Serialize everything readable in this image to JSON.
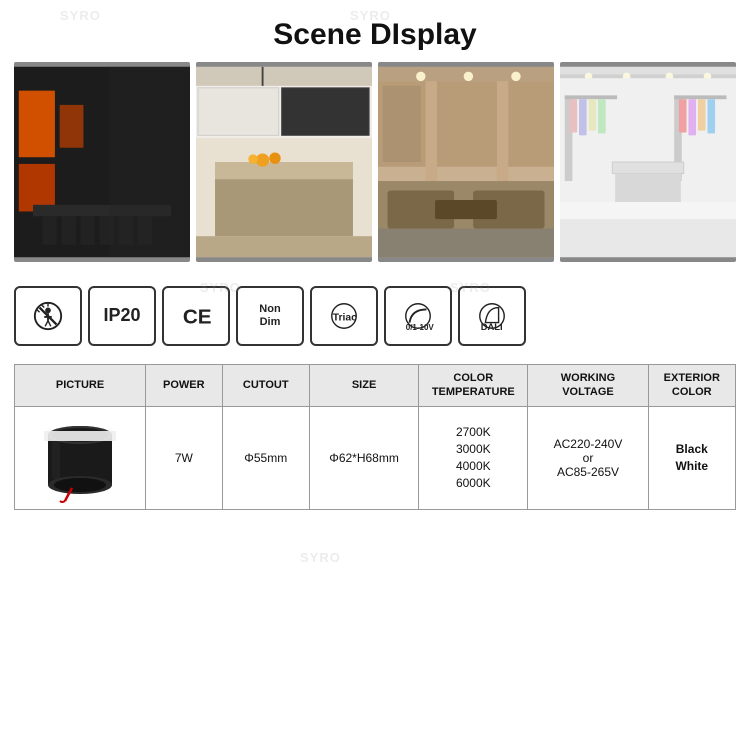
{
  "page": {
    "title": "Scene DIsplay",
    "watermarks": [
      "SYRO",
      "SYRO",
      "SYRO",
      "SYRO",
      "SYRO"
    ]
  },
  "scene_images": [
    {
      "id": 1,
      "alt": "Conference room with dark walls and orange lighting"
    },
    {
      "id": 2,
      "alt": "Modern kitchen with white and dark cabinets"
    },
    {
      "id": 3,
      "alt": "Restaurant or lobby with warm lighting"
    },
    {
      "id": 4,
      "alt": "Retail store with bright white lighting"
    }
  ],
  "icons": [
    {
      "id": "warning",
      "label": "Warning/Anti-glare",
      "symbol": "⚠"
    },
    {
      "id": "ip20",
      "label": "IP20",
      "text": "IP20"
    },
    {
      "id": "ce",
      "label": "CE",
      "text": "CE"
    },
    {
      "id": "non-dim",
      "label": "Non Dim",
      "text": "Non\nDim"
    },
    {
      "id": "triac",
      "label": "Triac",
      "text": "Triac"
    },
    {
      "id": "0-1-10v",
      "label": "0/1-10V",
      "text": "0/1-10V"
    },
    {
      "id": "dali",
      "label": "DALI",
      "text": "DALI"
    }
  ],
  "table": {
    "headers": [
      "PICTURE",
      "POWER",
      "CUTOUT",
      "SIZE",
      "COLOR\nTEMPERATURE",
      "WORKING\nVOLTAGE",
      "EXTERIOR\nCOLOR"
    ],
    "rows": [
      {
        "power": "7W",
        "cutout": "Φ55mm",
        "size": "Φ62*H68mm",
        "color_temps": [
          "2700K",
          "3000K",
          "4000K",
          "6000K"
        ],
        "working_voltage_line1": "AC220-240V",
        "working_voltage_line2": "or",
        "working_voltage_line3": "AC85-265V",
        "exterior_colors": [
          "Black",
          "White"
        ]
      }
    ]
  }
}
